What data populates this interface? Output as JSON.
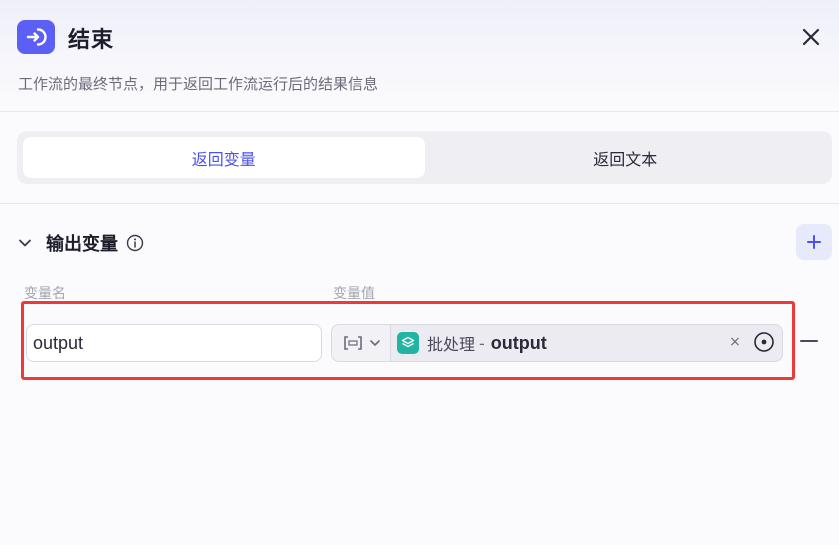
{
  "header": {
    "title": "结束",
    "description": "工作流的最终节点，用于返回工作流运行后的结果信息",
    "accent_color": "#5b5ff5"
  },
  "tabs": [
    {
      "label": "返回变量",
      "active": true
    },
    {
      "label": "返回文本",
      "active": false
    }
  ],
  "section": {
    "title": "输出变量",
    "columns": {
      "name": "变量名",
      "value": "变量值"
    }
  },
  "row": {
    "name_value": "output",
    "type_icon": "array-bracket-icon",
    "reference": {
      "node": "批处理",
      "separator": "-",
      "variable": "output",
      "node_color": "#23b3a3"
    },
    "clear_symbol": "×"
  },
  "highlight_color": "#ec3a3a"
}
